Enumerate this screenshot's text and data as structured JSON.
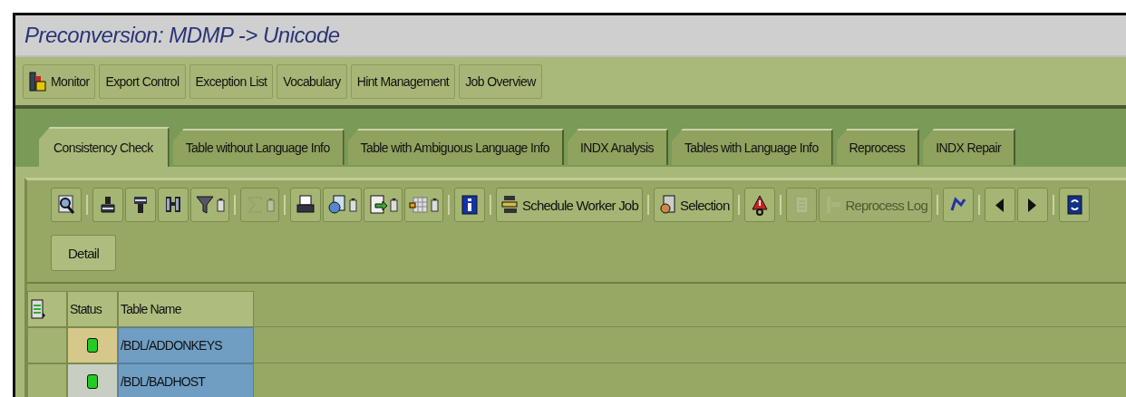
{
  "window": {
    "title": "Preconversion: MDMP -> Unicode"
  },
  "app_toolbar": [
    {
      "label": "Monitor",
      "has_icon": true
    },
    {
      "label": "Export Control",
      "has_icon": false
    },
    {
      "label": "Exception List",
      "has_icon": false
    },
    {
      "label": "Vocabulary",
      "has_icon": false
    },
    {
      "label": "Hint Management",
      "has_icon": false
    },
    {
      "label": "Job Overview",
      "has_icon": false
    }
  ],
  "tabs": [
    {
      "label": "Consistency Check",
      "selected": true
    },
    {
      "label": "Table without Language Info",
      "selected": false
    },
    {
      "label": "Table with Ambiguous Language Info",
      "selected": false
    },
    {
      "label": "INDX Analysis",
      "selected": false
    },
    {
      "label": "Tables with Language Info",
      "selected": false
    },
    {
      "label": "Reprocess",
      "selected": false
    },
    {
      "label": "INDX Repair",
      "selected": false
    }
  ],
  "grid_toolbar": [
    [
      {
        "kind": "icon",
        "disabled": false
      }
    ],
    [
      {
        "kind": "icon",
        "disabled": false
      },
      {
        "kind": "icon",
        "disabled": false
      },
      {
        "kind": "icon",
        "disabled": false
      },
      {
        "kind": "menu",
        "disabled": false
      }
    ],
    [
      {
        "kind": "menu",
        "disabled": true
      }
    ],
    [
      {
        "kind": "icon",
        "disabled": false
      },
      {
        "kind": "menu",
        "disabled": false
      },
      {
        "kind": "menu",
        "disabled": false
      },
      {
        "kind": "menu",
        "disabled": false
      }
    ],
    [
      {
        "kind": "icon",
        "disabled": false
      }
    ],
    [
      {
        "kind": "text",
        "label": "Schedule Worker Job",
        "disabled": false
      }
    ],
    [
      {
        "kind": "text",
        "label": "Selection",
        "disabled": false
      }
    ],
    [
      {
        "kind": "icon",
        "disabled": false
      }
    ],
    [
      {
        "kind": "icon",
        "disabled": true
      },
      {
        "kind": "text",
        "label": "Reprocess Log",
        "disabled": true
      }
    ],
    [
      {
        "kind": "icon",
        "disabled": false
      }
    ],
    [
      {
        "kind": "icon",
        "disabled": false
      },
      {
        "kind": "icon",
        "disabled": false
      }
    ],
    [
      {
        "kind": "icon",
        "disabled": false
      }
    ]
  ],
  "detail_button": {
    "label": "Detail"
  },
  "table": {
    "columns": [
      "Status",
      "Table Name"
    ],
    "rows": [
      {
        "color": "#22cc22",
        "selected": true,
        "table_name": "/BDL/ADDONKEYS"
      },
      {
        "color": "#22cc22",
        "selected": false,
        "table_name": "/BDL/BADHOST"
      }
    ]
  }
}
